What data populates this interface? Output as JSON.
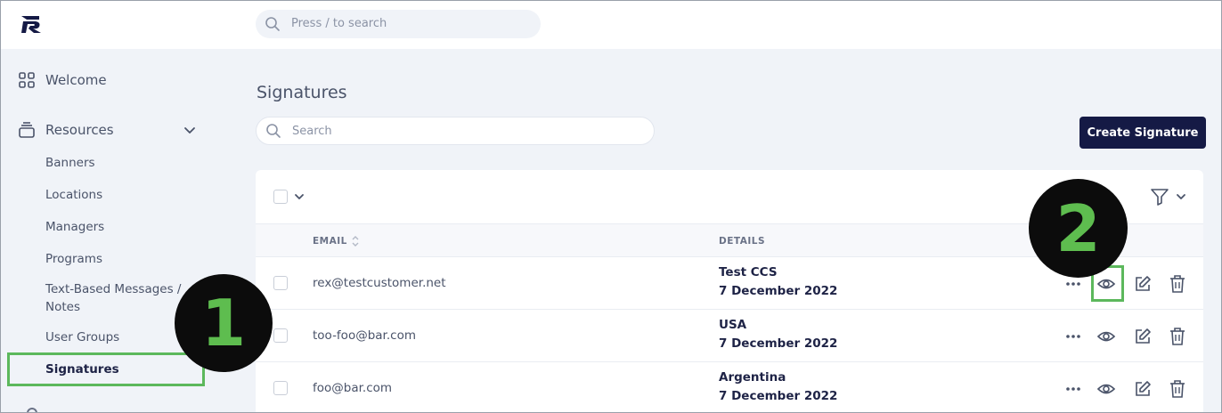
{
  "header": {
    "search_placeholder": "Press / to search"
  },
  "sidebar": {
    "welcome": "Welcome",
    "resources": "Resources",
    "items": [
      {
        "label": "Banners"
      },
      {
        "label": "Locations"
      },
      {
        "label": "Managers"
      },
      {
        "label": "Programs"
      },
      {
        "label": "Text-Based Messages /"
      },
      {
        "label": "Notes"
      },
      {
        "label": "User Groups"
      },
      {
        "label": "Signatures"
      }
    ]
  },
  "main": {
    "title": "Signatures",
    "search_placeholder": "Search",
    "create_label": "Create Signature",
    "columns": {
      "email": "EMAIL",
      "details": "DETAILS"
    },
    "rows": [
      {
        "email": "rex@testcustomer.net",
        "detail": "Test CCS",
        "date": "7 December 2022"
      },
      {
        "email": "too-foo@bar.com",
        "detail": "USA",
        "date": "7 December 2022"
      },
      {
        "email": "foo@bar.com",
        "detail": "Argentina",
        "date": "7 December 2022"
      }
    ]
  },
  "markers": {
    "one": "1",
    "two": "2"
  },
  "colors": {
    "accent": "#151a45",
    "highlight": "#5cb85c",
    "marker_text": "#5ebd4f"
  }
}
